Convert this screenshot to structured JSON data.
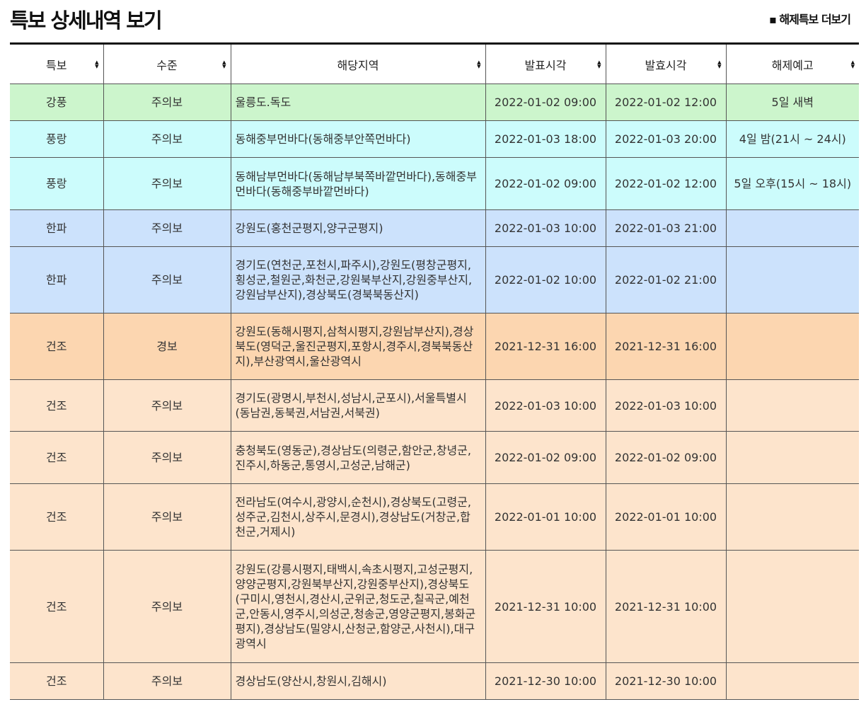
{
  "page": {
    "title": "특보 상세내역 보기",
    "more_link": "▪ 해제특보 더보기"
  },
  "colors": {
    "강풍": "#ccf5cc",
    "풍랑": "#ccfcfc",
    "한파": "#cce2fc",
    "건조_경보": "#fcd6b0",
    "건조_주의보": "#fde4cc"
  },
  "table": {
    "headers": [
      "특보",
      "수준",
      "해당지역",
      "발표시각",
      "발효시각",
      "해제예고"
    ],
    "rows": [
      {
        "type": "강풍",
        "level": "주의보",
        "region": "울릉도.독도",
        "announce": "2022-01-02 09:00",
        "effective": "2022-01-02 12:00",
        "release": "5일 새벽",
        "color": "#ccf5cc"
      },
      {
        "type": "풍랑",
        "level": "주의보",
        "region": "동해중부먼바다(동해중부안쪽먼바다)",
        "announce": "2022-01-03 18:00",
        "effective": "2022-01-03 20:00",
        "release": "4일 밤(21시 ~ 24시)",
        "color": "#ccfcfc"
      },
      {
        "type": "풍랑",
        "level": "주의보",
        "region": "동해남부먼바다(동해남부북쪽바깥먼바다),동해중부먼바다(동해중부바깥먼바다)",
        "announce": "2022-01-02 09:00",
        "effective": "2022-01-02 12:00",
        "release": "5일 오후(15시 ~ 18시)",
        "color": "#ccfcfc"
      },
      {
        "type": "한파",
        "level": "주의보",
        "region": "강원도(홍천군평지,양구군평지)",
        "announce": "2022-01-03 10:00",
        "effective": "2022-01-03 21:00",
        "release": "",
        "color": "#cce2fc"
      },
      {
        "type": "한파",
        "level": "주의보",
        "region": "경기도(연천군,포천시,파주시),강원도(평창군평지,횡성군,철원군,화천군,강원북부산지,강원중부산지,강원남부산지),경상북도(경북북동산지)",
        "announce": "2022-01-02 10:00",
        "effective": "2022-01-02 21:00",
        "release": "",
        "color": "#cce2fc"
      },
      {
        "type": "건조",
        "level": "경보",
        "region": "강원도(동해시평지,삼척시평지,강원남부산지),경상북도(영덕군,울진군평지,포항시,경주시,경북북동산지),부산광역시,울산광역시",
        "announce": "2021-12-31 16:00",
        "effective": "2021-12-31 16:00",
        "release": "",
        "color": "#fcd6b0"
      },
      {
        "type": "건조",
        "level": "주의보",
        "region": "경기도(광명시,부천시,성남시,군포시),서울특별시(동남권,동북권,서남권,서북권)",
        "announce": "2022-01-03 10:00",
        "effective": "2022-01-03 10:00",
        "release": "",
        "color": "#fde4cc"
      },
      {
        "type": "건조",
        "level": "주의보",
        "region": "충청북도(영동군),경상남도(의령군,함안군,창녕군,진주시,하동군,통영시,고성군,남해군)",
        "announce": "2022-01-02 09:00",
        "effective": "2022-01-02 09:00",
        "release": "",
        "color": "#fde4cc"
      },
      {
        "type": "건조",
        "level": "주의보",
        "region": "전라남도(여수시,광양시,순천시),경상북도(고령군,성주군,김천시,상주시,문경시),경상남도(거창군,합천군,거제시)",
        "announce": "2022-01-01 10:00",
        "effective": "2022-01-01 10:00",
        "release": "",
        "color": "#fde4cc"
      },
      {
        "type": "건조",
        "level": "주의보",
        "region": "강원도(강릉시평지,태백시,속초시평지,고성군평지,양양군평지,강원북부산지,강원중부산지),경상북도(구미시,영천시,경산시,군위군,청도군,칠곡군,예천군,안동시,영주시,의성군,청송군,영양군평지,봉화군평지),경상남도(밀양시,산청군,함양군,사천시),대구광역시",
        "announce": "2021-12-31 10:00",
        "effective": "2021-12-31 10:00",
        "release": "",
        "color": "#fde4cc"
      },
      {
        "type": "건조",
        "level": "주의보",
        "region": "경상남도(양산시,창원시,김해시)",
        "announce": "2021-12-30 10:00",
        "effective": "2021-12-30 10:00",
        "release": "",
        "color": "#fde4cc"
      }
    ]
  }
}
